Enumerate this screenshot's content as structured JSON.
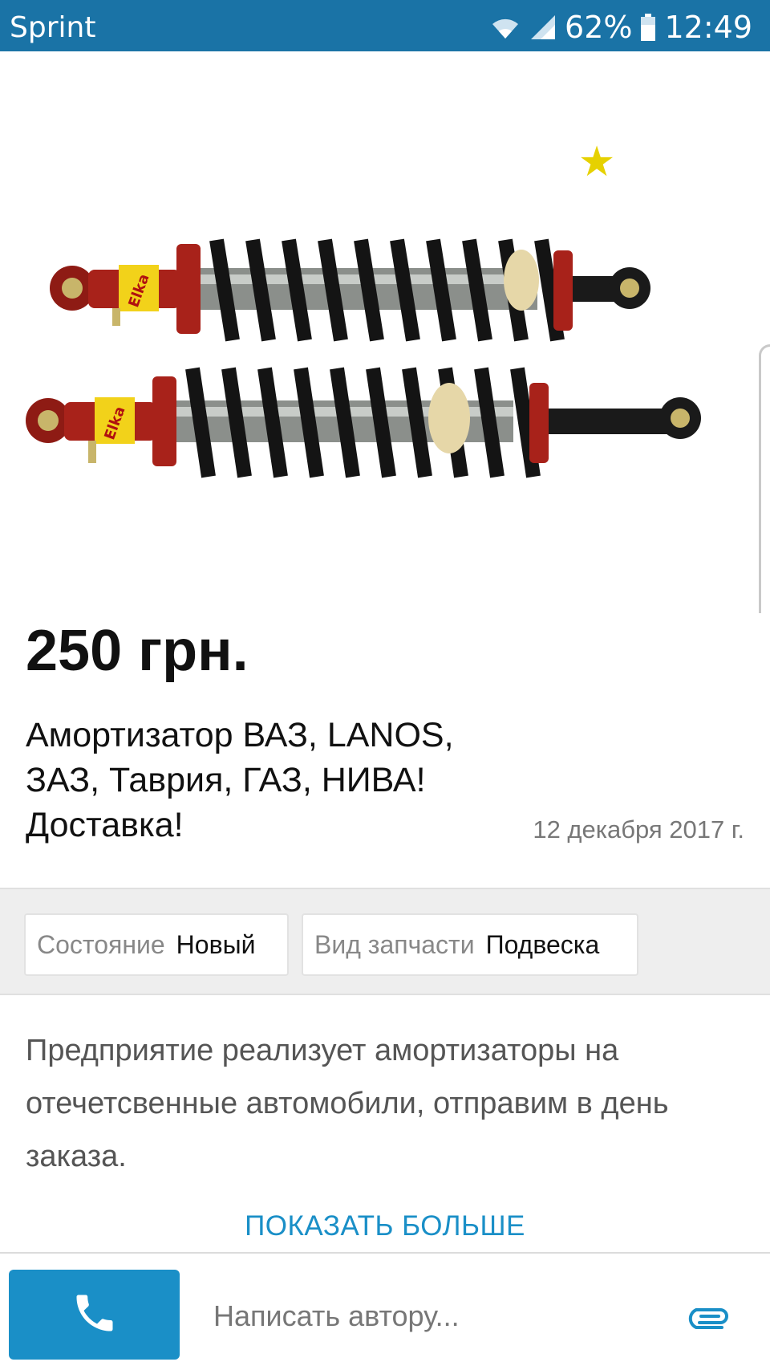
{
  "status_bar": {
    "carrier": "Sprint",
    "battery": "62%",
    "time": "12:49"
  },
  "listing": {
    "price": "250 грн.",
    "title_lines": [
      "Амортизатор ВАЗ, LANOS,",
      "ЗАЗ, Таврия, ГАЗ, НИВА!",
      "Доставка!"
    ],
    "date": "12 декабря 2017 г.",
    "favorite_icon": "star-icon",
    "image": "shock-absorbers-photo"
  },
  "params": [
    {
      "key": "Состояние",
      "value": "Новый"
    },
    {
      "key": "Вид запчасти",
      "value": "Подвеска"
    }
  ],
  "description": "Предприятие реализует амортизаторы на отечетсвенные автомобили, отправим в день заказа.",
  "show_more": "ПОКАЗАТЬ БОЛЬШЕ",
  "bottom_bar": {
    "call_icon": "phone-icon",
    "message_placeholder": "Написать автору...",
    "attach_icon": "paperclip-icon"
  },
  "colors": {
    "status_bar": "#1a73a6",
    "accent": "#1a8fc7",
    "star": "#e6d100"
  }
}
